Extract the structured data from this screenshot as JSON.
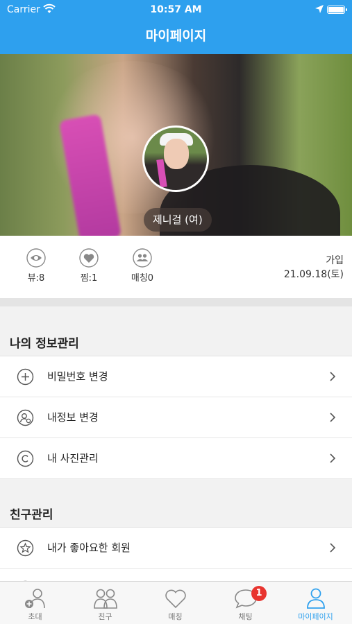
{
  "status_bar": {
    "carrier": "Carrier",
    "time": "10:57 AM"
  },
  "nav": {
    "title": "마이페이지"
  },
  "profile": {
    "name": "제니걸 (여)"
  },
  "stats": {
    "views": "뷰:8",
    "likes": "찜:1",
    "matches": "매칭0",
    "join_label": "가입",
    "join_date": "21.09.18(토)"
  },
  "sections": {
    "my_info": {
      "title": "나의 정보관리",
      "items": [
        {
          "label": "비밀번호 변경",
          "icon": "plus-circle-icon"
        },
        {
          "label": "내정보 변경",
          "icon": "user-settings-icon"
        },
        {
          "label": "내 사진관리",
          "icon": "copyright-icon"
        }
      ]
    },
    "friends": {
      "title": "친구관리",
      "items": [
        {
          "label": "내가 좋아요한 회원",
          "icon": "star-circle-icon"
        }
      ]
    }
  },
  "tabs": [
    {
      "label": "초대",
      "icon": "add-user-icon"
    },
    {
      "label": "친구",
      "icon": "friends-icon"
    },
    {
      "label": "매칭",
      "icon": "heart-icon"
    },
    {
      "label": "채팅",
      "icon": "chat-icon",
      "badge": "1"
    },
    {
      "label": "마이페이지",
      "icon": "person-icon",
      "active": true
    }
  ],
  "colors": {
    "accent": "#2ea0ee",
    "badge": "#e8342f"
  }
}
